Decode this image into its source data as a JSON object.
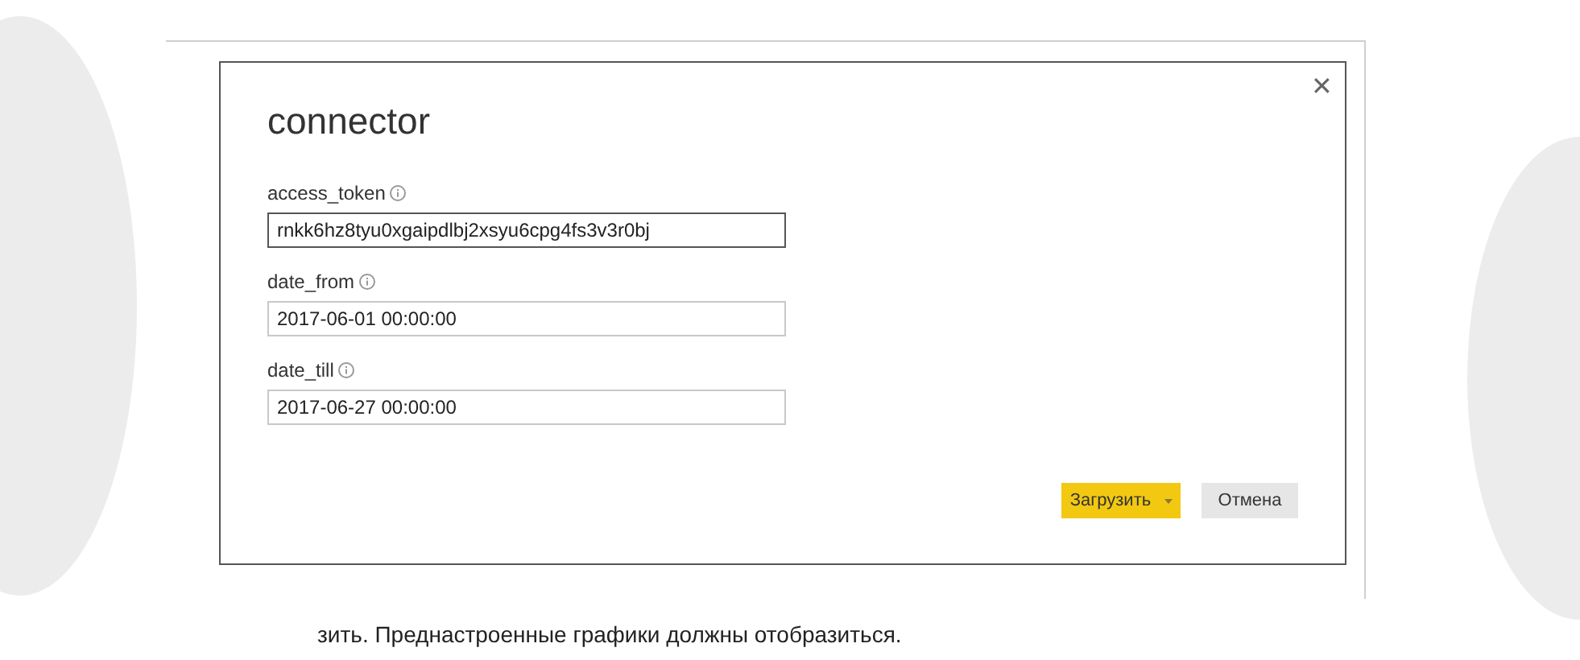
{
  "dialog": {
    "title": "connector",
    "close_glyph": "✕",
    "fields": [
      {
        "label": "access_token",
        "value": "rnkk6hz8tyu0xgaipdlbj2xsyu6cpg4fs3v3r0bj",
        "focused": true
      },
      {
        "label": "date_from",
        "value": "2017-06-01 00:00:00",
        "focused": false
      },
      {
        "label": "date_till",
        "value": "2017-06-27 00:00:00",
        "focused": false
      }
    ],
    "buttons": [
      {
        "kind": "primary",
        "label": "Загрузить"
      },
      {
        "kind": "secondary",
        "label": "Отмена"
      }
    ]
  },
  "caption": "зить. Преднастроенные графики должны отобразиться."
}
